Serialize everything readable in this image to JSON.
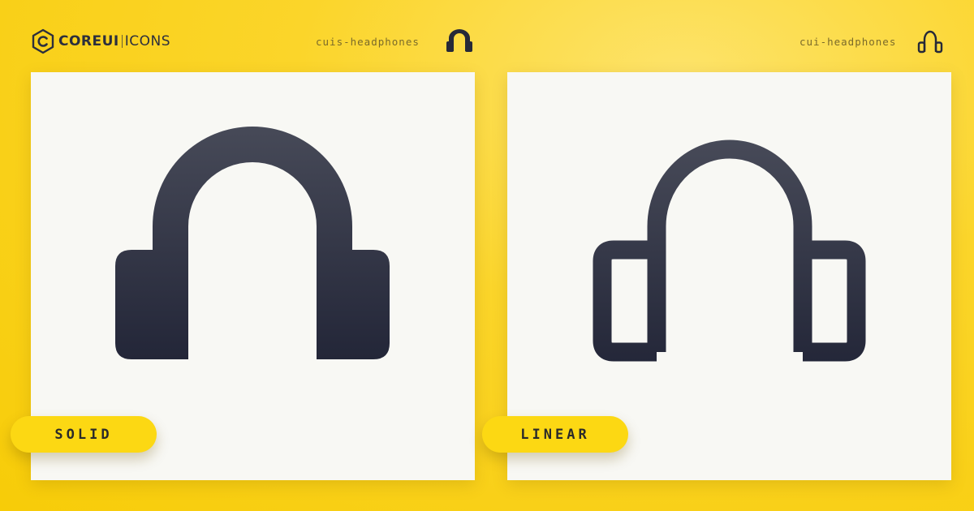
{
  "brand": {
    "name": "COREUI",
    "product": "ICONS",
    "hex_icon": "coreui-hex-logo-icon"
  },
  "panels": [
    {
      "icon_name": "cuis-headphones",
      "variant": "SOLID",
      "icon": "headphones-solid-icon"
    },
    {
      "icon_name": "cui-headphones",
      "variant": "LINEAR",
      "icon": "headphones-linear-icon"
    }
  ],
  "colors": {
    "background": "#f7cc08",
    "card": "#f8f8f4",
    "badge": "#fcd813",
    "icon_top": "#474a58",
    "icon_bottom": "#232638"
  }
}
